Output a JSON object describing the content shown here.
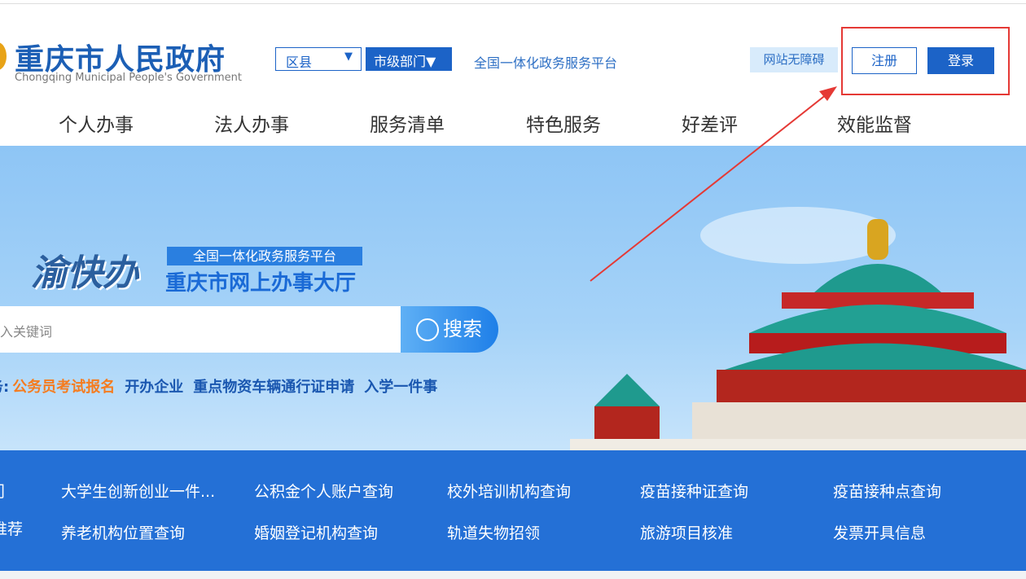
{
  "header": {
    "logo_cn": "重庆市人民政府",
    "logo_en": "Chongqing Municipal People's Government",
    "district_select": "区县",
    "dept_select": "市级部门▼",
    "platform_link": "全国一体化政务服务平台",
    "accessibility": "网站无障碍",
    "register": "注册",
    "login": "登录"
  },
  "nav": [
    "个人办事",
    "法人办事",
    "服务清单",
    "特色服务",
    "好差评",
    "效能监督"
  ],
  "banner": {
    "brand": "渝快办",
    "tag": "全国一体化政务服务平台",
    "hall": "重庆市网上办事大厅",
    "search_placeholder": "入关键词",
    "search_button": "搜索",
    "hot_prefix": "务:",
    "hot_items": [
      "公务员考试报名",
      "开办企业",
      "重点物资车辆通行证申请",
      "入学一件事"
    ]
  },
  "recommend": {
    "side_top": "门",
    "side_bottom": "推荐",
    "items": [
      "大学生创新创业一件...",
      "公积金个人账户查询",
      "校外培训机构查询",
      "疫苗接种证查询",
      "疫苗接种点查询",
      "养老机构位置查询",
      "婚姻登记机构查询",
      "轨道失物招领",
      "旅游项目核准",
      "发票开具信息"
    ]
  },
  "colors": {
    "primary": "#1c63c7",
    "annotation": "#e53935",
    "hot": "#f57c1f"
  }
}
